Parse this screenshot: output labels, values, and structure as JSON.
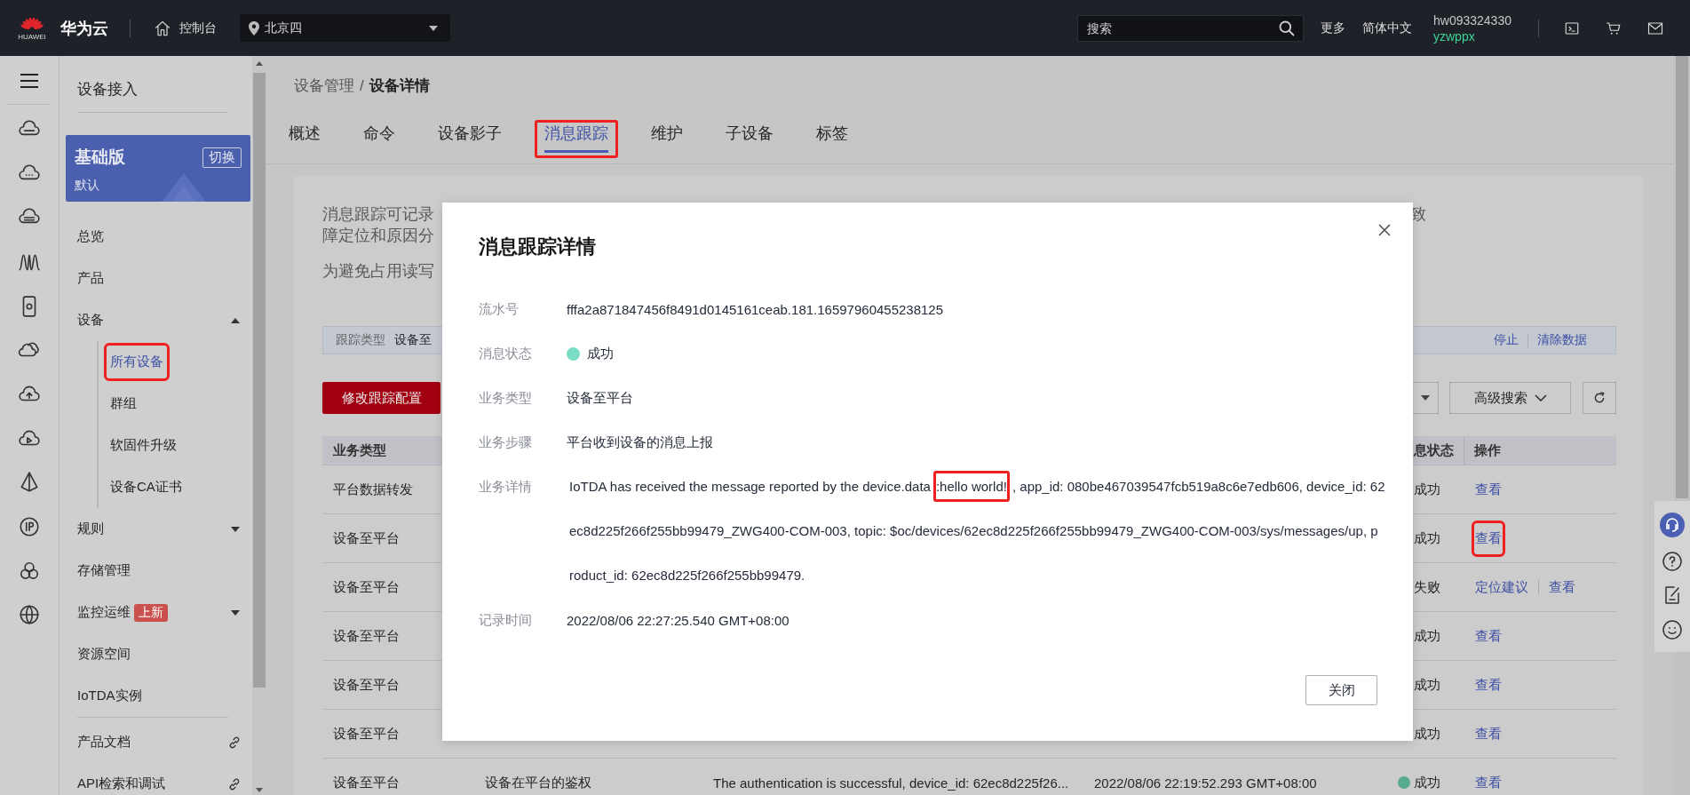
{
  "top_bar": {
    "logo_text": "HUAWEI",
    "brand": "华为云",
    "console": "控制台",
    "region": "北京四",
    "search": {
      "placeholder": "搜索"
    },
    "links": [
      "更多",
      "简体中文"
    ],
    "account": {
      "name": "hw093324330",
      "user": "yzwppx"
    }
  },
  "sidebar": {
    "title": "设备接入",
    "edition": {
      "name": "基础版",
      "switch": "切换",
      "label": "默认"
    },
    "items": [
      {
        "kind": "plain",
        "label": "总览"
      },
      {
        "kind": "plain",
        "label": "产品"
      },
      {
        "kind": "group",
        "label": "设备",
        "expanded": true,
        "children": [
          {
            "label": "所有设备",
            "selected": true,
            "highlighted": true
          },
          {
            "label": "群组",
            "selected": false,
            "highlighted": false
          },
          {
            "label": "软固件升级",
            "selected": false,
            "highlighted": false
          },
          {
            "label": "设备CA证书",
            "selected": false,
            "highlighted": false
          }
        ]
      },
      {
        "kind": "group",
        "label": "规则",
        "expanded": false
      },
      {
        "kind": "plain",
        "label": "存储管理"
      },
      {
        "kind": "group",
        "label": "监控运维",
        "expanded": false,
        "badge": "上新"
      },
      {
        "kind": "plain",
        "label": "资源空间"
      },
      {
        "kind": "plain",
        "label": "IoTDA实例"
      },
      {
        "kind": "link",
        "label": "产品文档"
      },
      {
        "kind": "link",
        "label": "API检索和调试"
      }
    ]
  },
  "breadcrumb": {
    "parent": "设备管理",
    "separator": "/",
    "current": "设备详情"
  },
  "tabs": [
    {
      "label": "概述",
      "selected": false,
      "highlighted": false
    },
    {
      "label": "命令",
      "selected": false,
      "highlighted": false
    },
    {
      "label": "设备影子",
      "selected": false,
      "highlighted": false
    },
    {
      "label": "消息跟踪",
      "selected": true,
      "highlighted": true
    },
    {
      "label": "维护",
      "selected": false,
      "highlighted": false
    },
    {
      "label": "子设备",
      "selected": false,
      "highlighted": false
    },
    {
      "label": "标签",
      "selected": false,
      "highlighted": false
    }
  ],
  "intro": [
    {
      "left": "消息跟踪可记录",
      "right": "致"
    },
    {
      "left": "障定位和原因分"
    }
  ],
  "note": "为避免占用读写",
  "filter": {
    "label": "跟踪类型",
    "value": "设备至",
    "actions": [
      "停止",
      "清除数据"
    ]
  },
  "toolbar": {
    "primary_button": "修改跟踪配置",
    "advanced_search": "高级搜索"
  },
  "table": {
    "header": {
      "column_1": "业务类型",
      "column_5": "息状态",
      "column_6": "操作"
    },
    "rows": [
      {
        "column_1": "平台数据转发",
        "status": "成功",
        "actions": [
          {
            "label": "查看",
            "highlighted": false
          }
        ]
      },
      {
        "column_1": "设备至平台",
        "status": "成功",
        "actions": [
          {
            "label": "查看",
            "highlighted": true
          }
        ]
      },
      {
        "column_1": "设备至平台",
        "status": "失败",
        "actions": [
          {
            "label": "定位建议",
            "highlighted": false
          },
          {
            "label": "查看",
            "highlighted": false
          }
        ]
      },
      {
        "column_1": "设备至平台",
        "status": "成功",
        "actions": [
          {
            "label": "查看",
            "highlighted": false
          }
        ]
      },
      {
        "column_1": "设备至平台",
        "status": "成功",
        "actions": [
          {
            "label": "查看",
            "highlighted": false
          }
        ]
      },
      {
        "column_1": "设备至平台",
        "status": "成功",
        "actions": [
          {
            "label": "查看",
            "highlighted": false
          }
        ]
      },
      {
        "column_1": "设备至平台",
        "column_2": "设备在平台的鉴权",
        "column_3": "The authentication is successful, device_id: 62ec8d225f26...",
        "column_4": "2022/08/06 22:19:52.293 GMT+08:00",
        "status": "成功",
        "color": "#5aaa90",
        "actions": [
          {
            "label": "查看",
            "highlighted": false
          }
        ]
      }
    ]
  },
  "modal": {
    "title": "消息跟踪详情",
    "fields": [
      {
        "kind": "text",
        "label": "流水号",
        "value": "fffa2a871847456f8491d0145161ceab.181.16597960455238125"
      },
      {
        "kind": "status",
        "label": "消息状态",
        "value": "成功",
        "color": "#7adcc4"
      },
      {
        "kind": "text",
        "label": "业务类型",
        "value": "设备至平台"
      },
      {
        "kind": "text",
        "label": "业务步骤",
        "value": "平台收到设备的消息上报"
      },
      {
        "kind": "lines",
        "label": "业务详情",
        "lines": [
          [
            {
              "text": "IoTDA has received the message reported by the device.data",
              "highlighted": false
            },
            {
              "text": ":hello world!",
              "highlighted": true
            },
            {
              "text": ", app_id: 080be467039547fcb519a8c6e7edb606, device_id: 62",
              "highlighted": false
            }
          ],
          [
            {
              "text": "ec8d225f266f255bb99479_ZWG400-COM-003, topic: $oc/devices/62ec8d225f266f255bb99479_ZWG400-COM-003/sys/messages/up, p",
              "highlighted": false
            }
          ],
          [
            {
              "text": "roduct_id: 62ec8d225f266f255bb99479.",
              "highlighted": false
            }
          ]
        ]
      },
      {
        "kind": "text",
        "label": "记录时间",
        "value": "2022/08/06 22:27:25.540 GMT+08:00"
      }
    ],
    "close_button": "关闭"
  }
}
